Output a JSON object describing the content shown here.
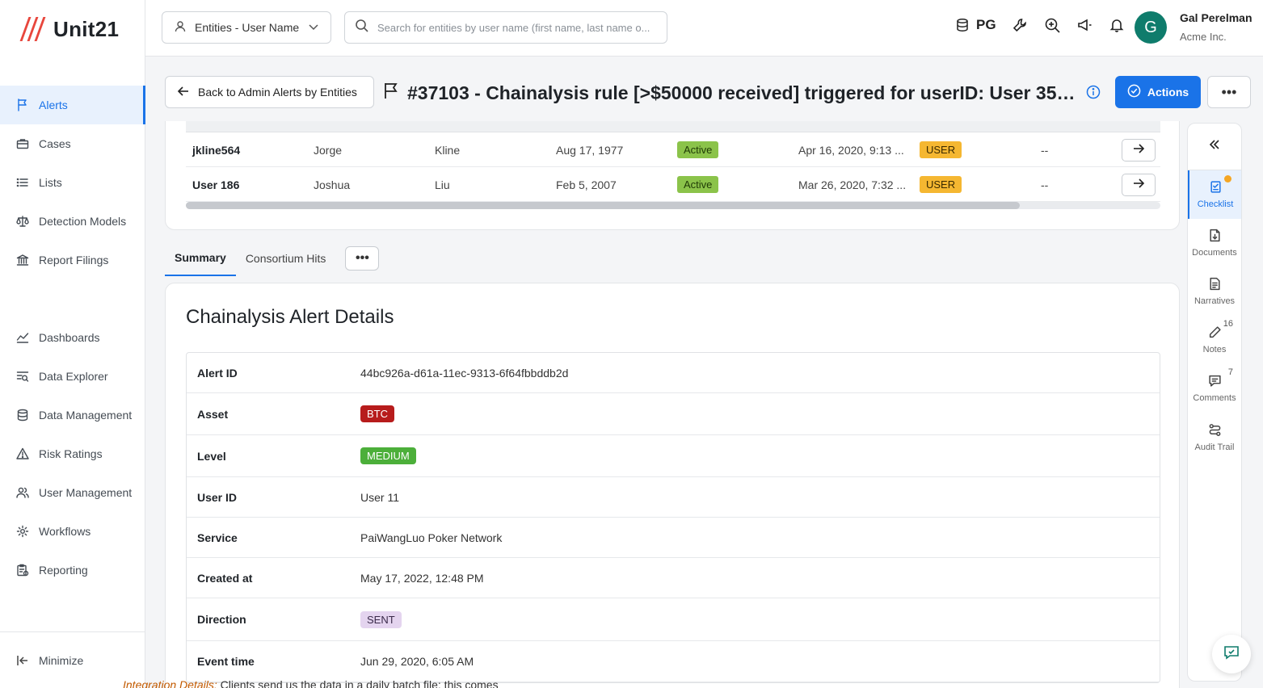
{
  "app": {
    "logo_text": "Unit21"
  },
  "sidebar": {
    "items": [
      {
        "label": "Alerts",
        "icon": "flag-icon",
        "active": true
      },
      {
        "label": "Cases",
        "icon": "briefcase-icon"
      },
      {
        "label": "Lists",
        "icon": "list-icon"
      },
      {
        "label": "Detection Models",
        "icon": "scale-icon"
      },
      {
        "label": "Report Filings",
        "icon": "bank-icon"
      },
      {
        "label": "Dashboards",
        "icon": "chart-icon"
      },
      {
        "label": "Data Explorer",
        "icon": "data-search-icon"
      },
      {
        "label": "Data Management",
        "icon": "database-icon"
      },
      {
        "label": "Risk Ratings",
        "icon": "warning-icon"
      },
      {
        "label": "User Management",
        "icon": "users-icon"
      },
      {
        "label": "Workflows",
        "icon": "gear-icon"
      },
      {
        "label": "Reporting",
        "icon": "report-icon"
      }
    ],
    "minimize_label": "Minimize"
  },
  "topbar": {
    "entity_select": "Entities - User Name",
    "search_placeholder": "Search for entities by user name (first name, last name o...",
    "env_label": "PG",
    "user_initial": "G",
    "user_name": "Gal Perelman",
    "user_org": "Acme Inc."
  },
  "header": {
    "back_label": "Back to Admin Alerts by Entities",
    "title": "#37103 - Chainalysis rule [>$50000 received] triggered for userID: User 352...",
    "actions_label": "Actions",
    "more_label": "•••"
  },
  "entities": {
    "rows": [
      {
        "user": "jkline564",
        "first": "Jorge",
        "last": "Kline",
        "dob": "Aug 17, 1977",
        "status": "Active",
        "date": "Apr 16, 2020, 9:13 ...",
        "type": "USER",
        "extra": "--"
      },
      {
        "user": "User 186",
        "first": "Joshua",
        "last": "Liu",
        "dob": "Feb 5, 2007",
        "status": "Active",
        "date": "Mar 26, 2020, 7:32 ...",
        "type": "USER",
        "extra": "--"
      }
    ]
  },
  "tabs": [
    {
      "label": "Summary",
      "active": true
    },
    {
      "label": "Consortium Hits"
    }
  ],
  "tab_more": "•••",
  "details": {
    "title": "Chainalysis Alert Details",
    "rows": [
      {
        "key": "Alert ID",
        "value": "44bc926a-d61a-11ec-9313-6f64fbbddb2d"
      },
      {
        "key": "Asset",
        "value": "BTC",
        "pill_bg": "#b71c1c",
        "pill_fg": "#ffffff"
      },
      {
        "key": "Level",
        "value": "MEDIUM",
        "pill_bg": "#4caf3a",
        "pill_fg": "#ffffff"
      },
      {
        "key": "User ID",
        "value": "User 11"
      },
      {
        "key": "Service",
        "value": "PaiWangLuo Poker Network"
      },
      {
        "key": "Created at",
        "value": "May 17, 2022, 12:48 PM"
      },
      {
        "key": "Direction",
        "value": "SENT",
        "pill_bg": "#e4d4ef",
        "pill_fg": "#3a2a4a"
      },
      {
        "key": "Event time",
        "value": "Jun 29, 2020, 6:05 AM"
      }
    ]
  },
  "rail": {
    "items": [
      {
        "label": "Checklist",
        "icon": "checklist-icon",
        "active": true,
        "dot": true
      },
      {
        "label": "Documents",
        "icon": "document-icon"
      },
      {
        "label": "Narratives",
        "icon": "narrative-icon"
      },
      {
        "label": "Notes",
        "icon": "pencil-icon",
        "count": "16"
      },
      {
        "label": "Comments",
        "icon": "comment-icon",
        "count": "7"
      },
      {
        "label": "Audit Trail",
        "icon": "audit-icon"
      }
    ]
  },
  "bottom_peek": {
    "highlight": "Integration Details:",
    "text": " Clients send us the data in a daily batch file; this comes"
  },
  "colors": {
    "accent": "#1a73e8",
    "active_green": "#8bc34a",
    "user_orange": "#f5b731"
  }
}
